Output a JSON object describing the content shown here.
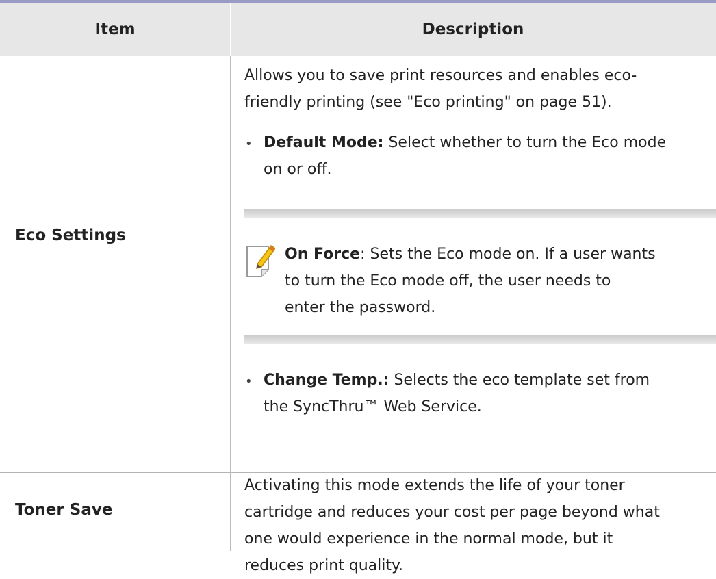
{
  "table": {
    "headers": {
      "item": "Item",
      "description": "Description"
    },
    "rows": [
      {
        "item": "Eco Settings",
        "intro": "Allows you to save print resources and enables eco-friendly printing (see \"Eco printing\" on page 51).",
        "intro_lines": [
          "Allows you to save print resources and enables eco-",
          "friendly printing (see \"Eco printing\" on page 51)."
        ],
        "bullets": [
          {
            "term": "Default Mode:",
            "lines": [
              "Select whether to turn the Eco mode",
              "on or off."
            ]
          },
          {
            "term": "Change Temp.:",
            "lines": [
              "Selects the eco template set from",
              "the SyncThru™ Web Service."
            ]
          }
        ],
        "note": {
          "icon": "note-icon",
          "term": "On Force",
          "lines": [
            ": Sets the Eco mode on. If a user wants",
            "to turn the Eco mode off, the user needs to",
            "enter the password."
          ]
        }
      },
      {
        "item": "Toner Save",
        "lines": [
          "Activating this mode extends the life of your toner",
          "cartridge and reduces your cost per page beyond what",
          "one would experience in the normal mode, but it",
          "reduces print quality."
        ]
      }
    ]
  },
  "colors": {
    "top_rule": "#9a9cc6",
    "header_bg": "#e7e7e7",
    "text": "#222222"
  }
}
